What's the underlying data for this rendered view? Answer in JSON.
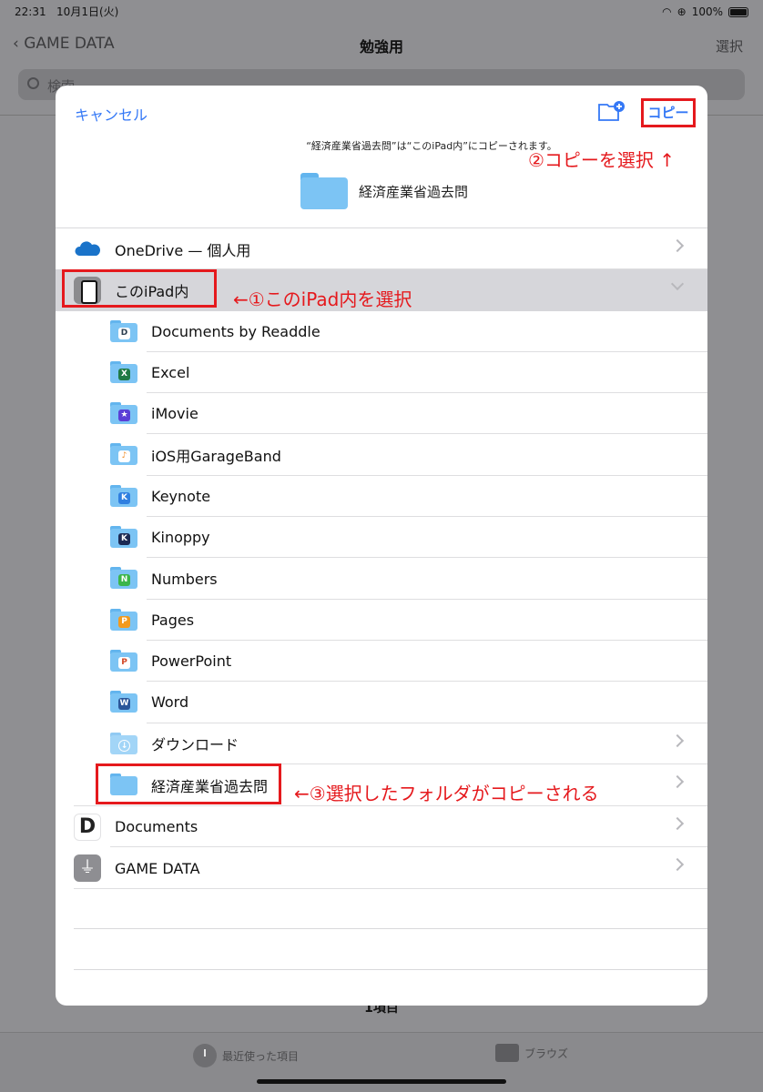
{
  "status_bar": {
    "time": "22:31",
    "date": "10月1日(火)",
    "battery": "100%"
  },
  "background": {
    "back_label": "GAME DATA",
    "title": "勉強用",
    "select_label": "選択",
    "search_placeholder": "検索",
    "item_count": "1項目",
    "tabs": [
      {
        "label": "最近使った項目"
      },
      {
        "label": "ブラウズ"
      }
    ]
  },
  "dialog": {
    "cancel_label": "キャンセル",
    "copy_label": "コピー",
    "message": "“経済産業省過去問”は“このiPad内”にコピーされます。",
    "folder_name": "経済産業省過去問",
    "locations": [
      {
        "label": "OneDrive — 個人用",
        "icon": "onedrive-icon",
        "chevron": "right"
      },
      {
        "label": "このiPad内",
        "icon": "ipad-icon",
        "chevron": "down",
        "selected": true
      },
      {
        "label": "Documents",
        "icon": "documents-app-icon",
        "chevron": "right"
      },
      {
        "label": "GAME DATA",
        "icon": "usb-icon",
        "chevron": "right"
      }
    ],
    "ipad_folders": [
      {
        "label": "Documents by Readdle",
        "badge": "D",
        "badge_color": "#2c3e50",
        "chevron": false
      },
      {
        "label": "Excel",
        "badge": "X",
        "badge_color": "#1f7a45",
        "chevron": false
      },
      {
        "label": "iMovie",
        "badge": "★",
        "badge_color": "#5b3fd6",
        "chevron": false
      },
      {
        "label": "iOS用GarageBand",
        "badge": "♪",
        "badge_color": "#f08a24",
        "chevron": false
      },
      {
        "label": "Keynote",
        "badge": "K",
        "badge_color": "#2f7fe0",
        "chevron": false
      },
      {
        "label": "Kinoppy",
        "badge": "K",
        "badge_color": "#1c2a54",
        "chevron": false
      },
      {
        "label": "Numbers",
        "badge": "N",
        "badge_color": "#3bb54a",
        "chevron": false
      },
      {
        "label": "Pages",
        "badge": "P",
        "badge_color": "#f39a1e",
        "chevron": false
      },
      {
        "label": "PowerPoint",
        "badge": "P",
        "badge_color": "#d24726",
        "chevron": false
      },
      {
        "label": "Word",
        "badge": "W",
        "badge_color": "#2b579a",
        "chevron": false
      },
      {
        "label": "ダウンロード",
        "badge": "↓",
        "badge_color": "#7cc4f4",
        "chevron": true
      },
      {
        "label": "経済産業省過去問",
        "badge": "",
        "badge_color": "",
        "chevron": true
      }
    ]
  },
  "annotations": {
    "step1": "←①このiPad内を選択",
    "step2": "②コピーを選択 ↑",
    "step3": "←③選択したフォルダがコピーされる"
  }
}
